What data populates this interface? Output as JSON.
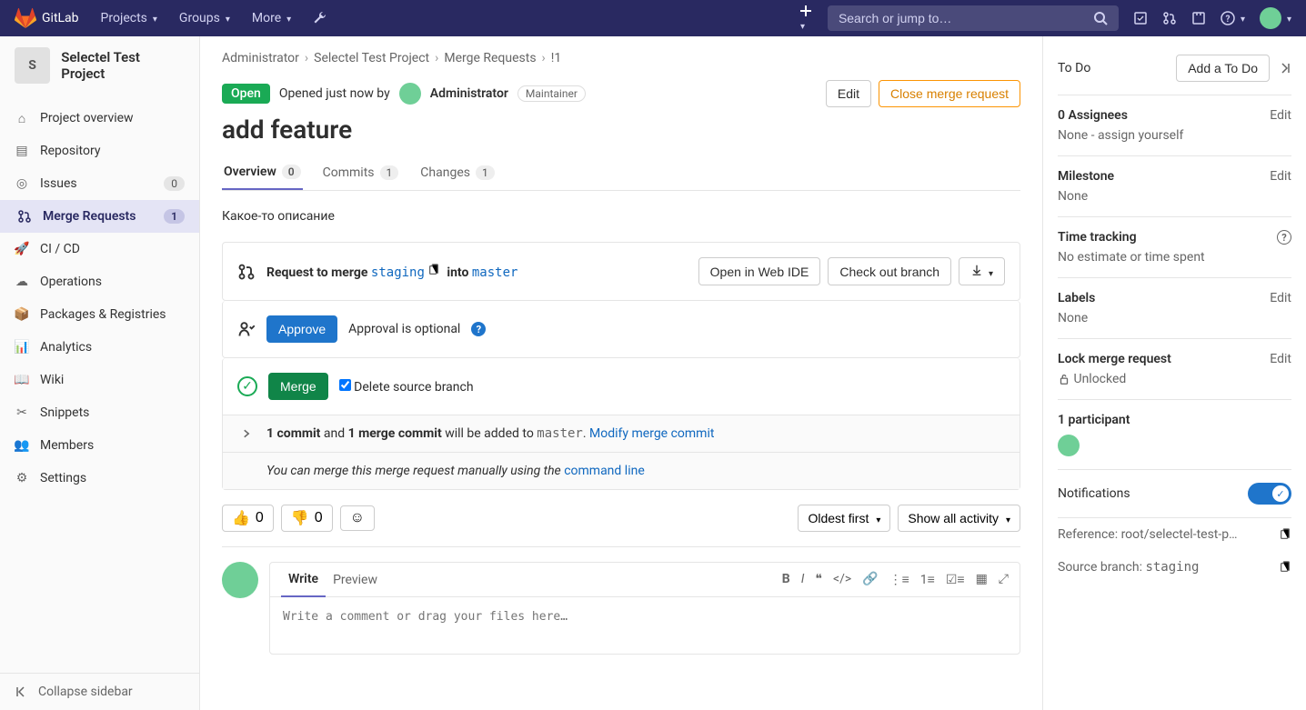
{
  "topnav": {
    "brand": "GitLab",
    "items": [
      "Projects",
      "Groups",
      "More"
    ],
    "searchPlaceholder": "Search or jump to…"
  },
  "sidebar": {
    "projectInitial": "S",
    "projectName": "Selectel Test Project",
    "items": [
      {
        "label": "Project overview",
        "icon": "home"
      },
      {
        "label": "Repository",
        "icon": "repo"
      },
      {
        "label": "Issues",
        "icon": "issues",
        "badge": "0"
      },
      {
        "label": "Merge Requests",
        "icon": "merge",
        "badge": "1",
        "active": true
      },
      {
        "label": "CI / CD",
        "icon": "rocket"
      },
      {
        "label": "Operations",
        "icon": "ops"
      },
      {
        "label": "Packages & Registries",
        "icon": "package"
      },
      {
        "label": "Analytics",
        "icon": "chart"
      },
      {
        "label": "Wiki",
        "icon": "book"
      },
      {
        "label": "Snippets",
        "icon": "scissors"
      },
      {
        "label": "Members",
        "icon": "members"
      },
      {
        "label": "Settings",
        "icon": "gear"
      }
    ],
    "collapse": "Collapse sidebar"
  },
  "breadcrumbs": [
    "Administrator",
    "Selectel Test Project",
    "Merge Requests",
    "!1"
  ],
  "mr": {
    "status": "Open",
    "openedText": "Opened just now by",
    "author": "Administrator",
    "role": "Maintainer",
    "editBtn": "Edit",
    "closeBtn": "Close merge request",
    "title": "add feature",
    "tabs": [
      {
        "label": "Overview",
        "count": "0",
        "active": true
      },
      {
        "label": "Commits",
        "count": "1"
      },
      {
        "label": "Changes",
        "count": "1"
      }
    ],
    "description": "Какое-то описание",
    "mergeSource": {
      "prefix": "Request to merge",
      "source": "staging",
      "into": "into",
      "target": "master",
      "openIde": "Open in Web IDE",
      "checkout": "Check out branch"
    },
    "approval": {
      "btn": "Approve",
      "text": "Approval is optional"
    },
    "merge": {
      "btn": "Merge",
      "deleteLabel": "Delete source branch"
    },
    "commitInfo": {
      "commitCount": "1 commit",
      "and": " and ",
      "mergeCommit": "1 merge commit",
      "willBeAdded": " will be added to ",
      "target": "master",
      "period": ". ",
      "modifyLink": "Modify merge commit"
    },
    "manual": {
      "text": "You can merge this merge request manually using the ",
      "link": "command line"
    },
    "reactions": {
      "thumbsUp": "0",
      "thumbsDown": "0",
      "sortLabel": "Oldest first",
      "filterLabel": "Show all activity"
    },
    "comment": {
      "writeTab": "Write",
      "previewTab": "Preview",
      "placeholder": "Write a comment or drag your files here…"
    }
  },
  "rightSidebar": {
    "todoLabel": "To Do",
    "addTodo": "Add a To Do",
    "assignees": {
      "title": "0 Assignees",
      "edit": "Edit",
      "value": "None - assign yourself"
    },
    "milestone": {
      "title": "Milestone",
      "edit": "Edit",
      "value": "None"
    },
    "timeTracking": {
      "title": "Time tracking",
      "value": "No estimate or time spent"
    },
    "labels": {
      "title": "Labels",
      "edit": "Edit",
      "value": "None"
    },
    "lock": {
      "title": "Lock merge request",
      "edit": "Edit",
      "value": "Unlocked"
    },
    "participants": {
      "title": "1 participant"
    },
    "notifications": {
      "title": "Notifications"
    },
    "reference": {
      "label": "Reference: ",
      "value": "root/selectel-test-p…"
    },
    "sourceBranch": {
      "label": "Source branch: ",
      "value": "staging"
    }
  }
}
